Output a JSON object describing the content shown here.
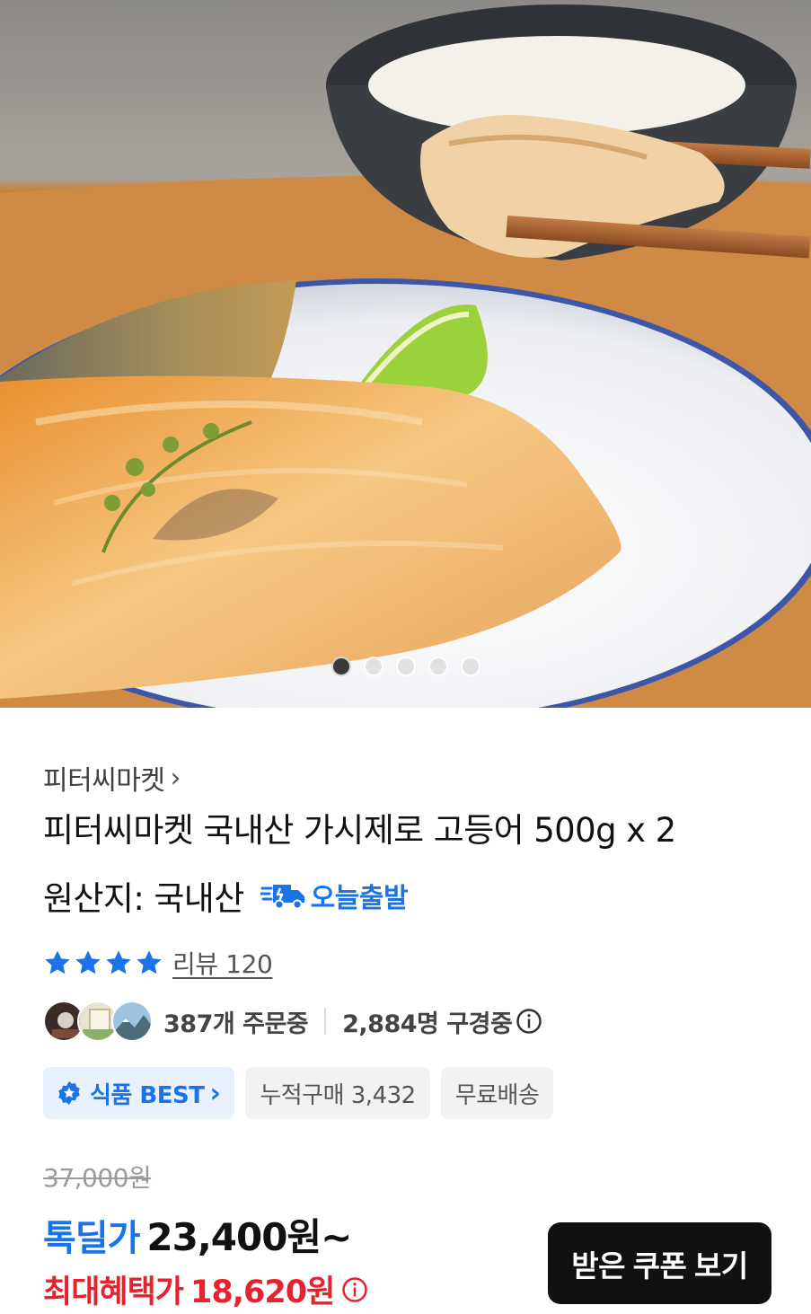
{
  "carousel": {
    "total": 5,
    "active_index": 0
  },
  "product": {
    "seller": "피터씨마켓",
    "title": "피터씨마켓 국내산 가시제로 고등어 500g x 2",
    "origin": "원산지: 국내산",
    "shipping_badge": "오늘출발",
    "rating": 5,
    "review_label": "리뷰 120",
    "order_stat": "387개 주문중",
    "view_stat": "2,884명 구경중",
    "chips": {
      "best": "식품 BEST",
      "cumulative": "누적구매 3,432",
      "free_shipping": "무료배송"
    },
    "original_price": "37,000원",
    "deal_label": "톡딜가",
    "deal_price": "23,400원~",
    "max_benefit_label": "최대혜택가",
    "max_benefit_price": "18,620원"
  },
  "coupon_button": "받은 쿠폰 보기",
  "colors": {
    "accent_blue": "#1a73e8",
    "price_red": "#e5222d",
    "button_dark": "#111111"
  },
  "icons": [
    "chevron-right-icon",
    "truck-icon",
    "star-icon",
    "info-icon",
    "best-badge-icon"
  ]
}
